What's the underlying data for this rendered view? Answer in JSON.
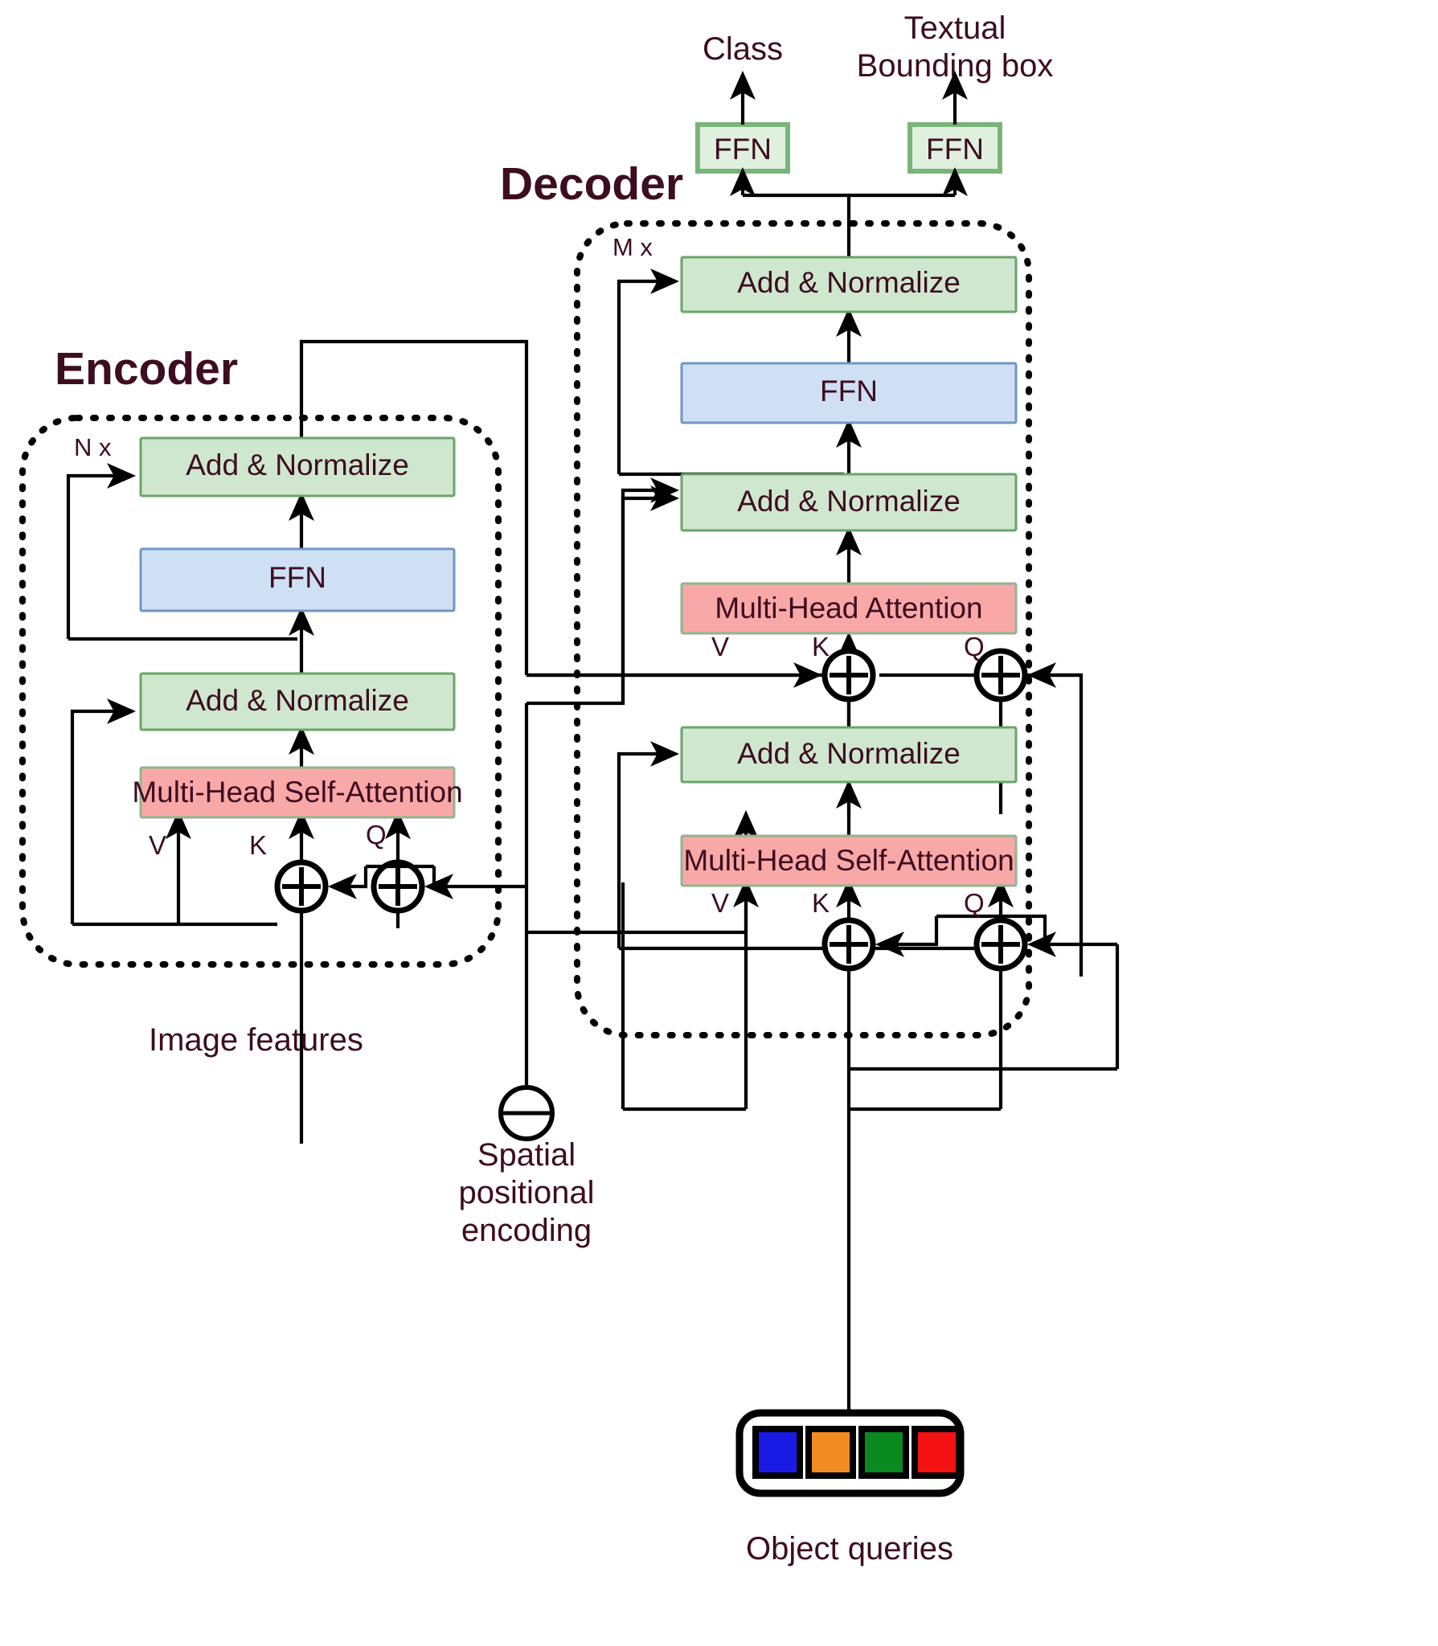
{
  "diagram": {
    "title_encoder": "Encoder",
    "title_decoder": "Decoder",
    "repeat_encoder": "N x",
    "repeat_decoder": "M x",
    "labels": {
      "add_norm": "Add  &  Normalize",
      "ffn": "FFN",
      "mhsa": "Multi-Head Self-Attention",
      "mha": "Multi-Head Attention",
      "v": "V",
      "k": "K",
      "q": "Q"
    },
    "outputs": {
      "class": "Class",
      "bbox_line1": "Textual",
      "bbox_line2": "Bounding box"
    },
    "inputs": {
      "image_features": "Image features",
      "object_queries": "Object queries",
      "spatial_pe_line1": "Spatial",
      "spatial_pe_line2": "positional",
      "spatial_pe_line3": "encoding"
    },
    "encoder_blocks": [
      {
        "id": "enc-add-norm-2",
        "label": "Add  &  Normalize",
        "kind": "green"
      },
      {
        "id": "enc-ffn",
        "label": "FFN",
        "kind": "blue"
      },
      {
        "id": "enc-add-norm-1",
        "label": "Add  &  Normalize",
        "kind": "green"
      },
      {
        "id": "enc-mhsa",
        "label": "Multi-Head Self-Attention",
        "kind": "red"
      }
    ],
    "decoder_blocks": [
      {
        "id": "dec-add-norm-3",
        "label": "Add  &  Normalize",
        "kind": "green"
      },
      {
        "id": "dec-ffn",
        "label": "FFN",
        "kind": "blue"
      },
      {
        "id": "dec-add-norm-2",
        "label": "Add  &  Normalize",
        "kind": "green"
      },
      {
        "id": "dec-mha",
        "label": "Multi-Head Attention",
        "kind": "red"
      },
      {
        "id": "dec-add-norm-1",
        "label": "Add  &  Normalize",
        "kind": "green"
      },
      {
        "id": "dec-mhsa",
        "label": "Multi-Head Self-Attention",
        "kind": "red"
      }
    ],
    "head_blocks": [
      {
        "id": "head-ffn-class",
        "label": "FFN"
      },
      {
        "id": "head-ffn-bbox",
        "label": "FFN"
      }
    ],
    "object_query_colors": [
      "#1a1ae6",
      "#f28b22",
      "#0a8a1e",
      "#f21212"
    ],
    "colors": {
      "text": "#3d0d20",
      "green_fill": "#cfe7cf",
      "green_stroke": "#6aa46a",
      "blue_fill": "#cfe0f5",
      "blue_stroke": "#6f97c4",
      "red_fill": "#f9a8a8",
      "line": "#000000",
      "background": "#ffffff"
    }
  }
}
